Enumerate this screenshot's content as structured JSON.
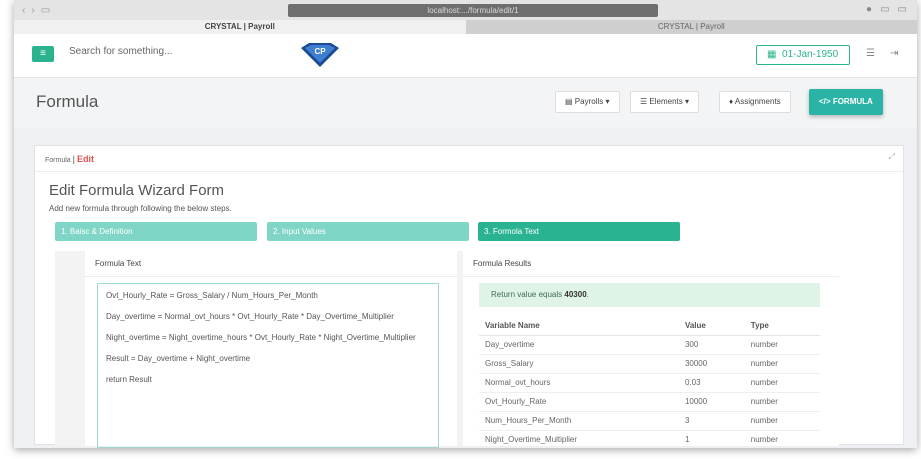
{
  "browser": {
    "url": "localhost:.../formula/edit/1",
    "tabs": [
      "CRYSTAL | Payroll",
      "CRYSTAL | Payroll"
    ]
  },
  "header": {
    "search_placeholder": "Search for something...",
    "logo_text": "CP",
    "date": "01-Jan-1950"
  },
  "page": {
    "title": "Formula",
    "buttons": {
      "payrolls": "Payrolls ▾",
      "elements": "Elements ▾",
      "assignments": "Assignments",
      "formula": "FORMULA"
    }
  },
  "card": {
    "breadcrumb": {
      "root": "Formula",
      "separator": "|",
      "current": "Edit"
    },
    "title": "Edit Formula Wizard Form",
    "subtitle": "Add new formula through following the below steps.",
    "steps": [
      "1. Baisc & Definition",
      "2. Input Values",
      "3. Formola Text"
    ],
    "active_step": 3
  },
  "formula_panel": {
    "heading": "Formula Text",
    "lines": [
      "Ovt_Hourly_Rate = Gross_Salary / Num_Hours_Per_Month",
      "Day_overtime = Normal_ovt_hours * Ovt_Hourly_Rate * Day_Overtime_Multiplier",
      "Night_overtime = Night_overtime_hours * Ovt_Hourly_Rate * Night_Overtime_Multiplier",
      "Result = Day_overtime + Night_overtime",
      "return Result"
    ]
  },
  "results_panel": {
    "heading": "Formula Results",
    "result_prefix": "Return value equals ",
    "result_value": "40300",
    "result_suffix": ".",
    "columns": [
      "Variable Name",
      "Value",
      "Type"
    ],
    "rows": [
      [
        "Day_overtime",
        "300",
        "number"
      ],
      [
        "Gross_Salary",
        "30000",
        "number"
      ],
      [
        "Normal_ovt_hours",
        "0.03",
        "number"
      ],
      [
        "Ovt_Hourly_Rate",
        "10000",
        "number"
      ],
      [
        "Num_Hours_Per_Month",
        "3",
        "number"
      ],
      [
        "Night_Overtime_Multiplier",
        "1",
        "number"
      ]
    ]
  },
  "colors": {
    "accent": "#2bb38f",
    "step_light": "#7fd6c6",
    "edit_red": "#e05252"
  }
}
